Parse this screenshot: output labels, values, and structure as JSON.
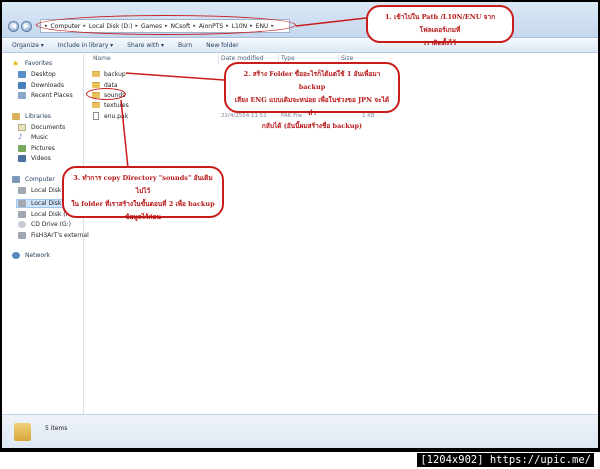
{
  "address": {
    "crumbs": [
      "Computer",
      "Local Disk (D:)",
      "Games",
      "NCsoft",
      "AionPTS",
      "L10N",
      "ENU"
    ]
  },
  "toolbar": {
    "organize": "Organize ▾",
    "include": "Include in library ▾",
    "share": "Share with ▾",
    "burn": "Burn",
    "new_folder": "New folder"
  },
  "nav": {
    "favorites": "Favorites",
    "desktop": "Desktop",
    "downloads": "Downloads",
    "recent": "Recent Places",
    "libraries": "Libraries",
    "documents": "Documents",
    "music": "Music",
    "pictures": "Pictures",
    "videos": "Videos",
    "computer": "Computer",
    "disk_c": "Local Disk (",
    "disk_d": "Local Disk (",
    "disk_f": "Local Disk (F",
    "cd": "CD Drive (G:)",
    "external": "FisH3ArT's external",
    "network": "Network"
  },
  "columns": {
    "name": "Name",
    "date": "Date modified",
    "type": "Type",
    "size": "Size"
  },
  "files": [
    {
      "name": "backup",
      "date": "",
      "type": "",
      "size": ""
    },
    {
      "name": "data",
      "date": "",
      "type": "",
      "size": ""
    },
    {
      "name": "sounds",
      "date": "",
      "type": "",
      "size": ""
    },
    {
      "name": "textures",
      "date": "",
      "type": "",
      "size": ""
    },
    {
      "name": "enu.pak",
      "date": "22/4/2554 11:52",
      "type": "PAK File",
      "size": "1 KB"
    }
  ],
  "status": {
    "count": "5 items"
  },
  "annotations": {
    "note1": [
      "1. เข้าไปใน Path /L10N/ENU จากโฟลเดอร์เกมที่",
      "เราติดตั้งไว้"
    ],
    "note2": [
      "2. สร้าง Folder ชื่ออะไรก็ได้แต่ใช้ 1 อันเพื่อมา backup",
      "เสียง ENG แบบเดิมจะหน่อย เพื่อในช่วงขอ JPN จะได้ทำ",
      "กลับได้ (อันนี้ผมสร้างชื่อ backup)"
    ],
    "note3": [
      "3. ทำการ copy Directory \"sounds\" อันเดิมไปไว้",
      "ใน folder ที่เราสร้างในขั้นตอนที่ 2 เพื่อ backup",
      "ข้อมูลไว้ก่อน"
    ]
  },
  "watermark": "[1204x902] https://upic.me/",
  "colors": {
    "annotation_red": "#c91c1c",
    "folder_yellow": "#e8c15d",
    "chrome_blue": "#dbe8f6"
  }
}
